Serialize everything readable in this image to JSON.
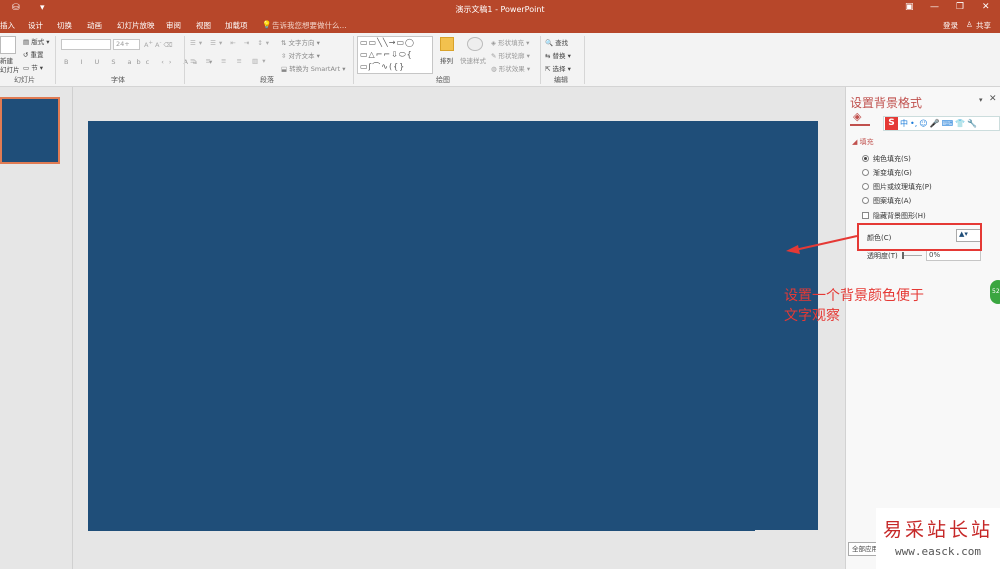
{
  "titlebar": {
    "title": "演示文稿1 - PowerPoint",
    "qa_save": "⛁",
    "qa_more": "▾",
    "ctl_ribbon": "▣",
    "ctl_min": "—",
    "ctl_max": "❐",
    "ctl_close": "✕"
  },
  "menu": {
    "tabs": [
      "插入",
      "设计",
      "切换",
      "动画",
      "幻灯片放映",
      "审阅",
      "视图",
      "加载项"
    ],
    "tell_me": "告诉我您想要做什么...",
    "login": "登录",
    "share": "共享"
  },
  "ribbon": {
    "slides": {
      "new_slide": "新建",
      "new_slide2": "幻灯片",
      "layout": "版式",
      "reset": "重置",
      "section": "节",
      "label": "幻灯片"
    },
    "font": {
      "size": "24+",
      "label": "字体"
    },
    "paragraph": {
      "text_direction": "文字方向",
      "align_text": "对齐文本",
      "smartart": "转换为 SmartArt",
      "label": "段落"
    },
    "drawing": {
      "arrange": "排列",
      "quick_styles": "快速样式",
      "shape_fill": "形状填充",
      "shape_outline": "形状轮廓",
      "shape_effects": "形状效果",
      "label": "绘图"
    },
    "editing": {
      "find": "查找",
      "replace": "替换",
      "select": "选择",
      "label": "编辑"
    }
  },
  "pane": {
    "title": "设置背景格式",
    "fill_section": "填充",
    "options": [
      "纯色填充(S)",
      "渐变填充(G)",
      "图片或纹理填充(P)",
      "图案填充(A)"
    ],
    "hide_bg": "隐藏背景图形(H)",
    "color_label": "颜色(C)",
    "transparency_label": "透明度(T)",
    "transparency_value": "0%",
    "apply_all": "全部应用"
  },
  "ime_toolbar": {
    "items": [
      "中",
      "•,",
      "☺",
      "🎤",
      "⌨",
      "👕",
      "🔧"
    ]
  },
  "annotation": {
    "line1": "设置一个背景颜色便于",
    "line2": "文字观察"
  },
  "watermark": {
    "cn": "易采站长站",
    "url": "www.easck.com"
  },
  "colors": {
    "accent": "#b7472a",
    "slide_bg": "#1f4e79",
    "annotation": "#e53935"
  }
}
